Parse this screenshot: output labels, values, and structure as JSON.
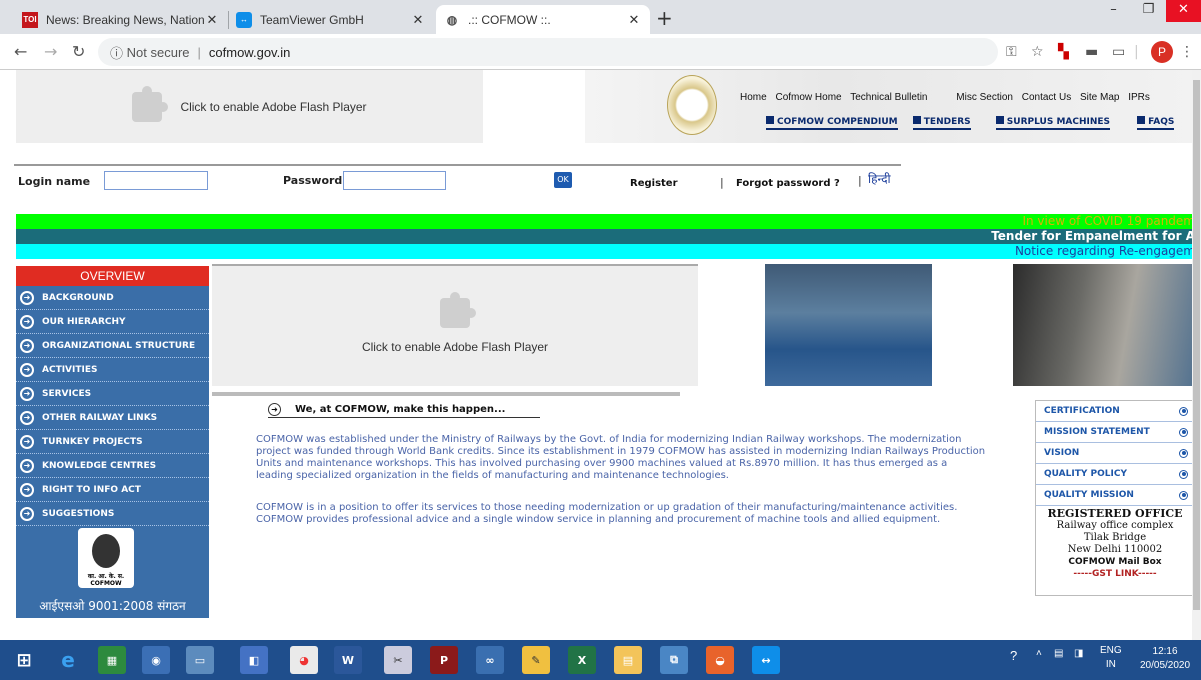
{
  "browser": {
    "tabs": [
      {
        "title": "News: Breaking News, National n",
        "favicon": "TOI",
        "active": false
      },
      {
        "title": "TeamViewer GmbH",
        "favicon": "teamviewer-icon",
        "active": false
      },
      {
        "title": ".:: COFMOW ::.",
        "favicon": "globe-icon",
        "active": true
      }
    ],
    "security": "Not secure",
    "url": "cofmow.gov.in",
    "profile_initial": "P"
  },
  "header": {
    "flash_text": "Click to enable Adobe Flash Player",
    "top_links": [
      "Home",
      "Cofmow Home",
      "Technical Bulletin",
      "Misc Section",
      "Contact Us",
      "Site Map",
      "IPRs"
    ],
    "sub_links": [
      "COFMOW COMPENDIUM",
      "TENDERS",
      "SURPLUS MACHINES",
      "FAQS"
    ]
  },
  "login": {
    "login_label": "Login name",
    "login_value": "",
    "password_label": "Password",
    "password_value": "",
    "ok_label": "OK",
    "register_label": "Register",
    "forgot_label": "Forgot password ?",
    "hindi_label": "हिन्दी"
  },
  "marquees": [
    {
      "text": "In view of COVID 19 pandem",
      "bg": "#00ff00",
      "color": "#d8b400"
    },
    {
      "text": "Tender for Empanelment for A",
      "bg": "#1b6c7a",
      "color": "#ffffff"
    },
    {
      "text": "Notice regarding Re-engagem",
      "bg": "#00ffff",
      "color": "#1c3f9c"
    }
  ],
  "sidebar": {
    "heading": "OVERVIEW",
    "items": [
      "BACKGROUND",
      "OUR HIERARCHY",
      "ORGANIZATIONAL STRUCTURE",
      "ACTIVITIES",
      "SERVICES",
      "OTHER RAILWAY LINKS",
      "TURNKEY PROJECTS",
      "KNOWLEDGE CENTRES",
      "RIGHT TO INFO ACT",
      "SUGGESTIONS"
    ],
    "logo_text": "का. आ. के. स. COFMOW",
    "footer": "आईएसओ 9001:2008 संगठन"
  },
  "main": {
    "flash_text": "Click to enable Adobe Flash Player",
    "tagline": "We, at COFMOW, make this happen...",
    "para1": "COFMOW was established under the Ministry of Railways by the Govt. of India for modernizing Indian Railway workshops. The modernization project was funded through World Bank credits. Since its establishment in 1979 COFMOW has assisted in modernizing Indian Railways Production Units and maintenance workshops. This has involved purchasing over 9900 machines valued at Rs.8970 million. It has thus emerged as a leading specialized organization in the fields of manufacturing and maintenance technologies.",
    "para2": "COFMOW is in a position to offer its services to those needing modernization or up gradation of their manufacturing/maintenance activities. COFMOW provides professional advice and a single window service in planning and procurement of machine tools and allied equipment."
  },
  "right_panel": {
    "items": [
      "CERTIFICATION",
      "MISSION STATEMENT",
      "VISION",
      "QUALITY POLICY",
      "QUALITY MISSION"
    ],
    "office_heading": "REGISTERED OFFICE",
    "office_lines": [
      "Railway office complex",
      "Tilak Bridge",
      "New Delhi 110002"
    ],
    "mailbox": "COFMOW Mail Box",
    "gst": "-----GST LINK-----"
  },
  "taskbar": {
    "lang": "ENG",
    "region": "IN",
    "time": "12:16",
    "date": "20/05/2020"
  }
}
